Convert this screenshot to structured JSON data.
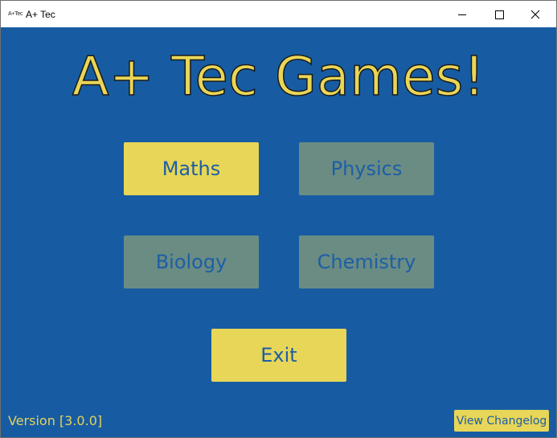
{
  "window": {
    "icon_text": "A+Tec",
    "title": "A+ Tec",
    "controls": {
      "minimize_icon": "minimize-icon",
      "maximize_icon": "maximize-icon",
      "close_icon": "close-icon"
    }
  },
  "main": {
    "heading": "A+ Tec Games!",
    "subjects": [
      {
        "label": "Maths",
        "state": "active"
      },
      {
        "label": "Physics",
        "state": "inactive"
      },
      {
        "label": "Biology",
        "state": "inactive"
      },
      {
        "label": "Chemistry",
        "state": "inactive"
      }
    ],
    "exit_label": "Exit"
  },
  "footer": {
    "version": "Version [3.0.0]",
    "changelog_label": "View Changelog"
  },
  "colors": {
    "background": "#175ca3",
    "accent_yellow": "#e7d657",
    "inactive_button": "#6a8c83",
    "button_text": "#1d5ea6",
    "version_text": "#e3d25a"
  }
}
